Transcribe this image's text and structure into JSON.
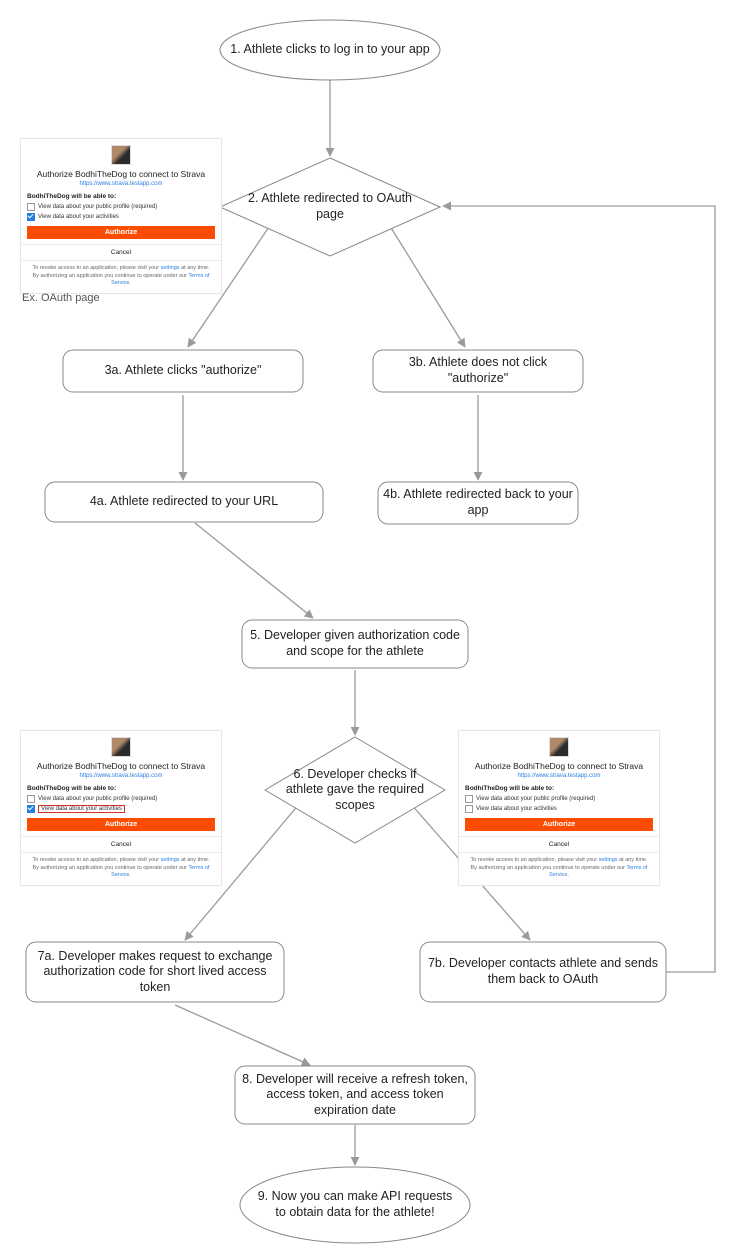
{
  "nodes": {
    "n1": "1. Athlete clicks to log in to your app",
    "n2": "2. Athlete redirected to OAuth page",
    "n3a": "3a. Athlete clicks \"authorize\"",
    "n3b": "3b. Athlete does not click \"authorize\"",
    "n4a": "4a. Athlete redirected to your URL",
    "n4b": "4b. Athlete redirected back to your app",
    "n5": "5. Developer given authorization code and scope for the athlete",
    "n6": "6. Developer checks if athlete gave the required scopes",
    "n7a": "7a. Developer makes request to exchange authorization code for short lived access token",
    "n7b": "7b. Developer contacts athlete and sends them back to OAuth",
    "n8": "8. Developer will receive a refresh token, access token, and access token expiration date",
    "n9": "9. Now you can make API requests to obtain data for the athlete!"
  },
  "caption": "Ex. OAuth page",
  "oauth": {
    "title": "Authorize BodhiTheDog to connect to Strava",
    "url": "https://www.strava.testapp.com",
    "sub": "BodhiTheDog will be able to:",
    "perm1": "View data about your public profile (required)",
    "perm2": "View data about your activities",
    "authorize": "Authorize",
    "cancel": "Cancel",
    "foot1_a": "To revoke access to an application, please visit your ",
    "foot1_link": "settings",
    "foot1_b": " at any time.",
    "foot2_a": "By authorizing an application you continue to operate under our ",
    "foot2_link": "Terms of Service",
    "foot2_b": "."
  }
}
